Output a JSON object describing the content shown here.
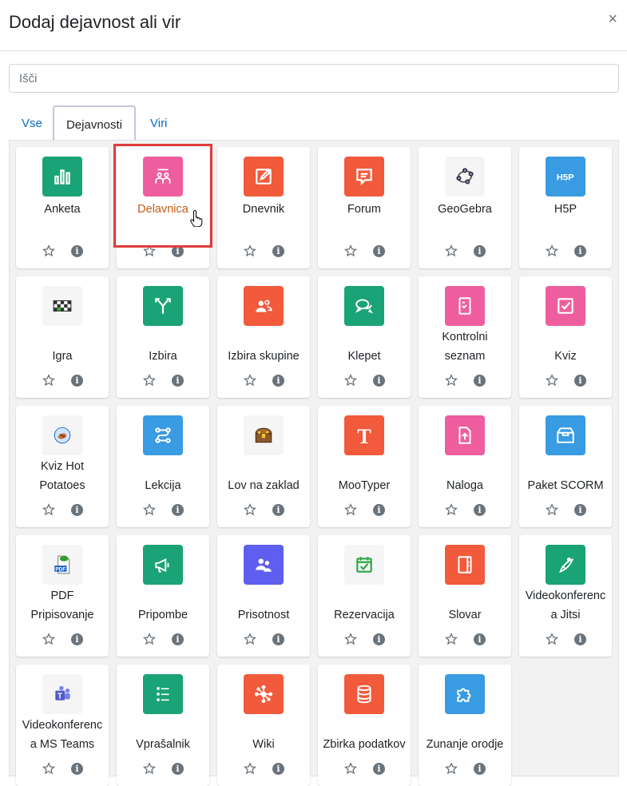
{
  "dialog": {
    "title": "Dodaj dejavnost ali vir",
    "close": "×"
  },
  "search": {
    "placeholder": "Išči",
    "value": ""
  },
  "tabs": [
    {
      "label": "Vse",
      "active": false
    },
    {
      "label": "Dejavnosti",
      "active": true
    },
    {
      "label": "Viri",
      "active": false
    }
  ],
  "colors": {
    "green": "#1aa376",
    "pink": "#ee5e9e",
    "orange": "#f15a3b",
    "blue": "#399be2",
    "purple": "#5e5ef0",
    "grey": "#f5f5f5",
    "highlight": "#e03c3c",
    "selected_text": "#c75b12"
  },
  "items": [
    {
      "label": "Anketa",
      "icon": "chart-bars-icon",
      "color": "green"
    },
    {
      "label": "Delavnica",
      "icon": "workshop-icon",
      "color": "pink",
      "selected": true
    },
    {
      "label": "Dnevnik",
      "icon": "journal-edit-icon",
      "color": "orange"
    },
    {
      "label": "Forum",
      "icon": "forum-bubble-icon",
      "color": "orange"
    },
    {
      "label": "GeoGebra",
      "icon": "geogebra-icon",
      "color": "grey"
    },
    {
      "label": "H5P",
      "icon": "h5p-icon",
      "color": "blue"
    },
    {
      "label": "Igra",
      "icon": "game-board-icon",
      "color": "grey"
    },
    {
      "label": "Izbira",
      "icon": "choice-arrows-icon",
      "color": "green"
    },
    {
      "label": "Izbira skupine",
      "icon": "group-choice-icon",
      "color": "orange"
    },
    {
      "label": "Klepet",
      "icon": "chat-icon",
      "color": "green"
    },
    {
      "label": "Kontrolni seznam",
      "line1": "Kontrolni",
      "line2": "seznam",
      "icon": "checklist-icon",
      "color": "pink"
    },
    {
      "label": "Kviz",
      "icon": "quiz-check-icon",
      "color": "pink"
    },
    {
      "label": "Kviz Hot Potatoes",
      "line1": "Kviz Hot",
      "line2": "Potatoes",
      "icon": "hotpot-icon",
      "color": "grey"
    },
    {
      "label": "Lekcija",
      "icon": "lesson-path-icon",
      "color": "blue"
    },
    {
      "label": "Lov na zaklad",
      "icon": "treasure-chest-icon",
      "color": "grey"
    },
    {
      "label": "MooTyper",
      "icon": "mootyper-t-icon",
      "color": "orange"
    },
    {
      "label": "Naloga",
      "icon": "assignment-upload-icon",
      "color": "pink"
    },
    {
      "label": "Paket SCORM",
      "icon": "scorm-box-icon",
      "color": "blue"
    },
    {
      "label": "PDF Pripisovanje",
      "line1": "PDF",
      "line2": "Pripisovanje",
      "icon": "pdf-annotation-icon",
      "color": "grey"
    },
    {
      "label": "Pripombe",
      "icon": "megaphone-icon",
      "color": "green"
    },
    {
      "label": "Prisotnost",
      "icon": "attendance-icon",
      "color": "purple"
    },
    {
      "label": "Rezervacija",
      "icon": "calendar-check-icon",
      "color": "grey"
    },
    {
      "label": "Slovar",
      "icon": "glossary-book-icon",
      "color": "orange"
    },
    {
      "label": "Videokonferenca Jitsi",
      "line1": "Videokonferenc",
      "line2": "a Jitsi",
      "icon": "jitsi-icon",
      "color": "green"
    },
    {
      "label": "Videokonferenca MS Teams",
      "line1": "Videokonferenc",
      "line2": "a MS Teams",
      "icon": "ms-teams-icon",
      "color": "grey"
    },
    {
      "label": "Vprašalnik",
      "icon": "questionnaire-list-icon",
      "color": "green"
    },
    {
      "label": "Wiki",
      "icon": "wiki-network-icon",
      "color": "orange"
    },
    {
      "label": "Zbirka podatkov",
      "icon": "database-icon",
      "color": "orange"
    },
    {
      "label": "Zunanje orodje",
      "icon": "puzzle-icon",
      "color": "blue"
    }
  ],
  "info_glyph": "i"
}
